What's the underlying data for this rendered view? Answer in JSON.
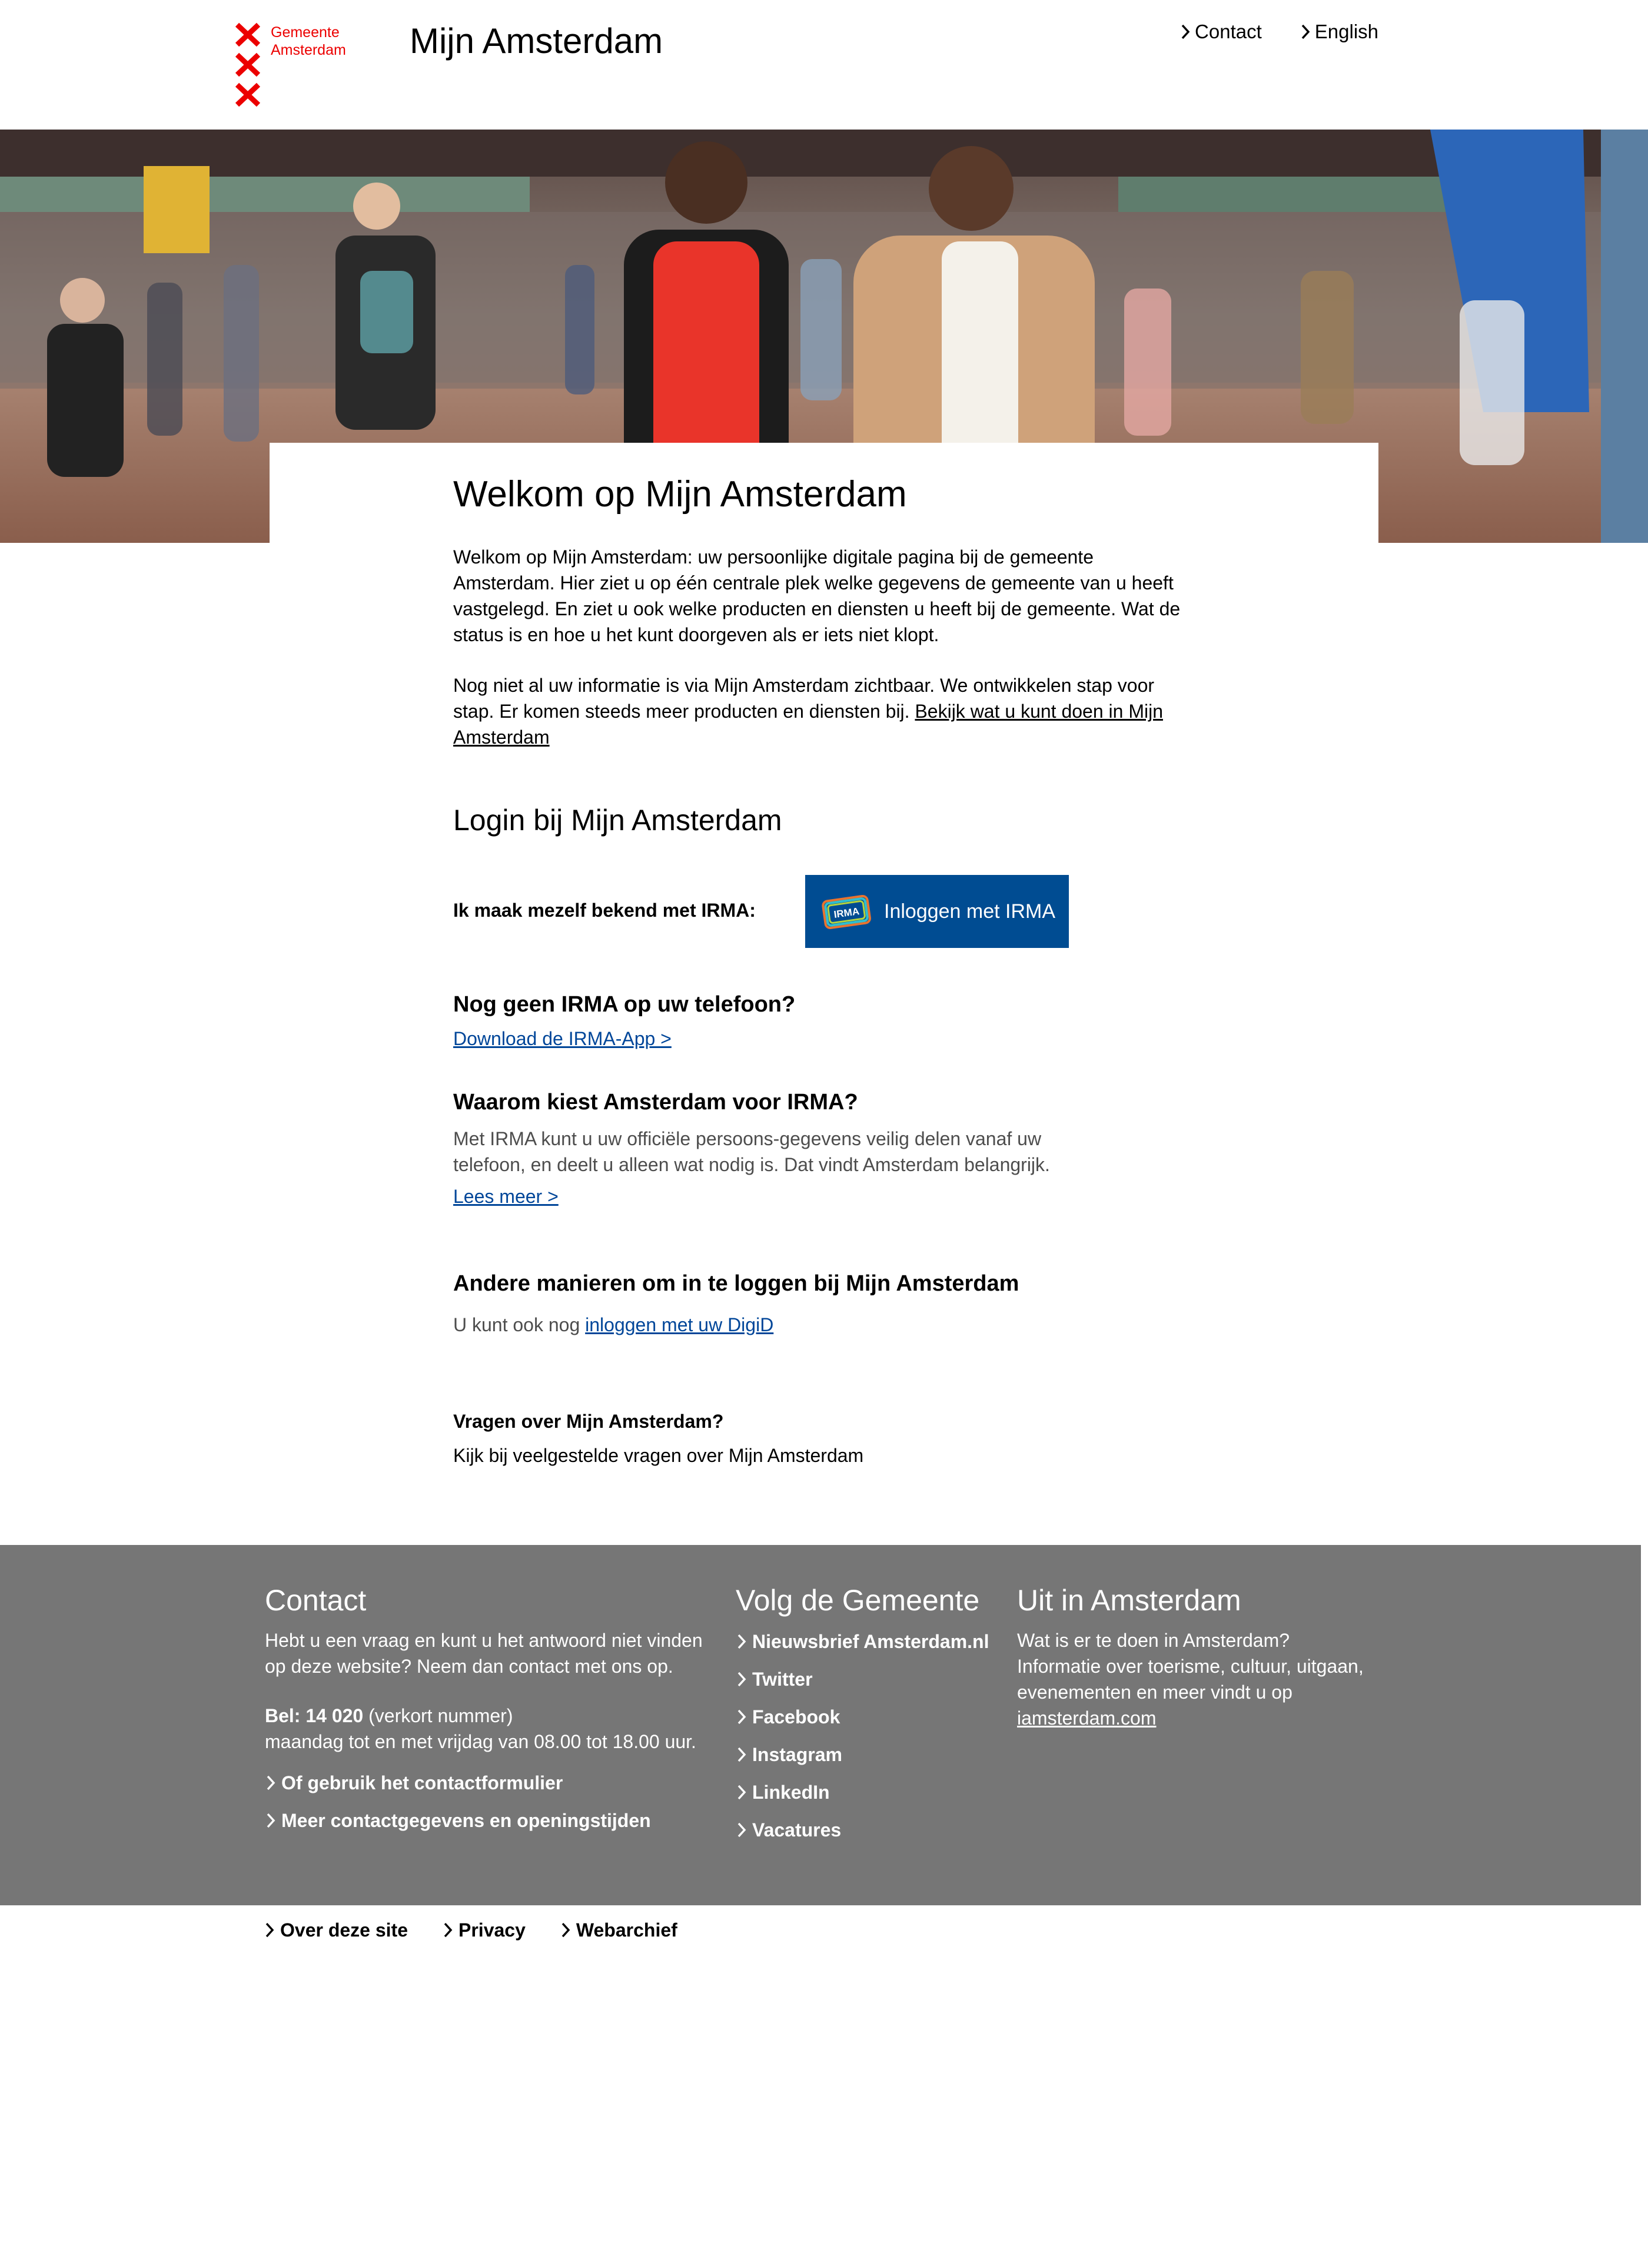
{
  "header": {
    "logo_line1": "Gemeente",
    "logo_line2": "Amsterdam",
    "title": "Mijn Amsterdam",
    "nav": [
      {
        "label": "Contact"
      },
      {
        "label": "English"
      }
    ]
  },
  "main": {
    "heading": "Welkom op Mijn Amsterdam",
    "intro_p1": "Welkom op Mijn Amsterdam: uw persoonlijke digitale pagina bij de gemeente Amsterdam. Hier ziet u op één centrale plek welke gegevens de gemeente van u heeft vastgelegd. En ziet u ook welke producten en diensten u heeft bij de gemeente. Wat de status is en hoe u het kunt doorgeven als er iets niet klopt.",
    "intro_p2": "Nog niet al uw informatie is via Mijn Amsterdam zichtbaar. We ontwikkelen stap voor stap. Er komen steeds meer producten en diensten bij.",
    "intro_link": "Bekijk wat u kunt doen in Mijn Amsterdam",
    "login_heading": "Login bij Mijn Amsterdam",
    "irma_label": "Ik maak mezelf bekend met IRMA:",
    "irma_logo_text": "IRMA",
    "irma_button": "Inloggen met IRMA",
    "no_irma_heading": "Nog geen IRMA op uw telefoon?",
    "download_link": "Download de IRMA-App >",
    "why_heading": "Waarom kiest Amsterdam voor IRMA?",
    "why_text": "Met IRMA kunt u uw officiële persoons-gegevens veilig delen vanaf uw telefoon, en deelt u alleen wat nodig is. Dat vindt Amsterdam belangrijk.",
    "read_more": "Lees meer >",
    "alt_heading": "Andere manieren om in te loggen bij Mijn Amsterdam",
    "alt_text": "U kunt ook nog",
    "alt_link": "inloggen met uw DigiD",
    "questions_heading": "Vragen over Mijn Amsterdam?",
    "questions_text": "Kijk bij veelgestelde vragen over Mijn Amsterdam"
  },
  "footer": {
    "contact": {
      "heading": "Contact",
      "text": "Hebt u een vraag en kunt u het antwoord niet vinden op deze website? Neem dan contact met ons op.",
      "phone_label": "Bel: 14 020",
      "phone_note": "(verkort nummer)",
      "hours": "maandag tot en met vrijdag van 08.00 tot 18.00 uur.",
      "links": [
        {
          "label": "Of gebruik het contactformulier"
        },
        {
          "label": "Meer contactgegevens en openingstijden"
        }
      ]
    },
    "follow": {
      "heading": "Volg de Gemeente",
      "links": [
        {
          "label": "Nieuwsbrief Amsterdam.nl"
        },
        {
          "label": "Twitter"
        },
        {
          "label": "Facebook"
        },
        {
          "label": "Instagram"
        },
        {
          "label": "LinkedIn"
        },
        {
          "label": "Vacatures"
        }
      ]
    },
    "uit": {
      "heading": "Uit in Amsterdam",
      "text": "Wat is er te doen in Amsterdam? Informatie over toerisme, cultuur, uitgaan, evenementen en meer vindt u op",
      "link": "iamsterdam.com"
    }
  },
  "bottom_links": [
    {
      "label": "Over deze site"
    },
    {
      "label": "Privacy"
    },
    {
      "label": "Webarchief"
    }
  ],
  "colors": {
    "brand_red": "#ec0000",
    "irma_blue": "#004c92",
    "link_blue": "#004699",
    "footer_gray": "#767676"
  },
  "icons": {
    "logo": "amsterdam-xxx-crosses",
    "nav": "chevron-right-icon",
    "irma": "irma-logo-icon"
  }
}
